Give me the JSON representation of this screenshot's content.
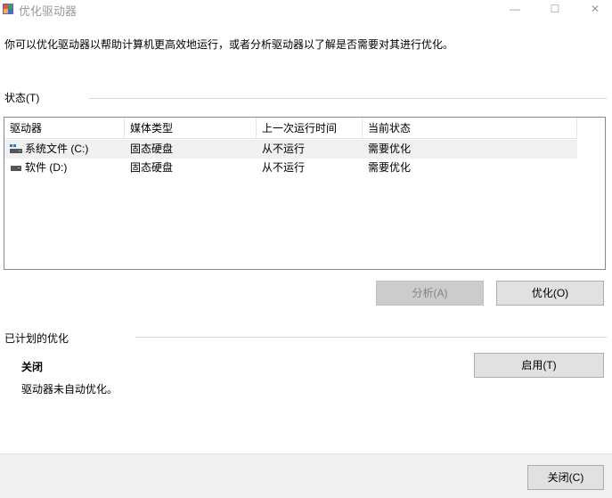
{
  "window": {
    "title": "优化驱动器",
    "controls": {
      "minimize": "—",
      "maximize": "☐",
      "close": "✕"
    }
  },
  "description": "你可以优化驱动器以帮助计算机更高效地运行，或者分析驱动器以了解是否需要对其进行优化。",
  "status": {
    "label": "状态(T)",
    "columns": [
      "驱动器",
      "媒体类型",
      "上一次运行时间",
      "当前状态"
    ],
    "rows": [
      {
        "drive": "系统文件 (C:)",
        "media": "固态硬盘",
        "last_run": "从不运行",
        "state": "需要优化",
        "icon": "system-drive-icon",
        "selected": true
      },
      {
        "drive": "软件 (D:)",
        "media": "固态硬盘",
        "last_run": "从不运行",
        "state": "需要优化",
        "icon": "drive-icon",
        "selected": false
      }
    ],
    "analyze_label": "分析(A)",
    "optimize_label": "优化(O)"
  },
  "schedule": {
    "label": "已计划的优化",
    "state": "关闭",
    "detail": "驱动器未自动优化。",
    "enable_label": "启用(T)"
  },
  "footer": {
    "close_label": "关闭(C)"
  },
  "colors": {
    "accent_drive_blue": "#1e7ad6",
    "button_face": "#e1e1e1",
    "disabled_button": "#cccccc"
  }
}
